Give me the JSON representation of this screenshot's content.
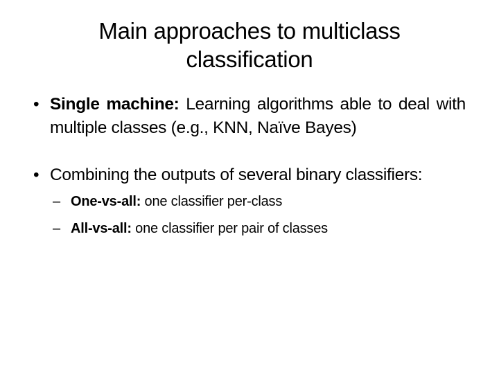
{
  "slide": {
    "title_line1": "Main approaches to multiclass",
    "title_line2": "classification",
    "bullets": [
      {
        "marker": "•",
        "bold": "Single machine:",
        "text": " Learning algorithms able to deal with multiple classes (e.g., KNN, Naïve Bayes)"
      },
      {
        "marker": "•",
        "bold": "",
        "text": "Combining the outputs of several binary classifiers:",
        "subitems": [
          {
            "marker": "–",
            "bold": "One-vs-all:",
            "text": " one classifier per-class"
          },
          {
            "marker": "–",
            "bold": "All-vs-all:",
            "text": " one classifier per pair of classes"
          }
        ]
      }
    ]
  }
}
